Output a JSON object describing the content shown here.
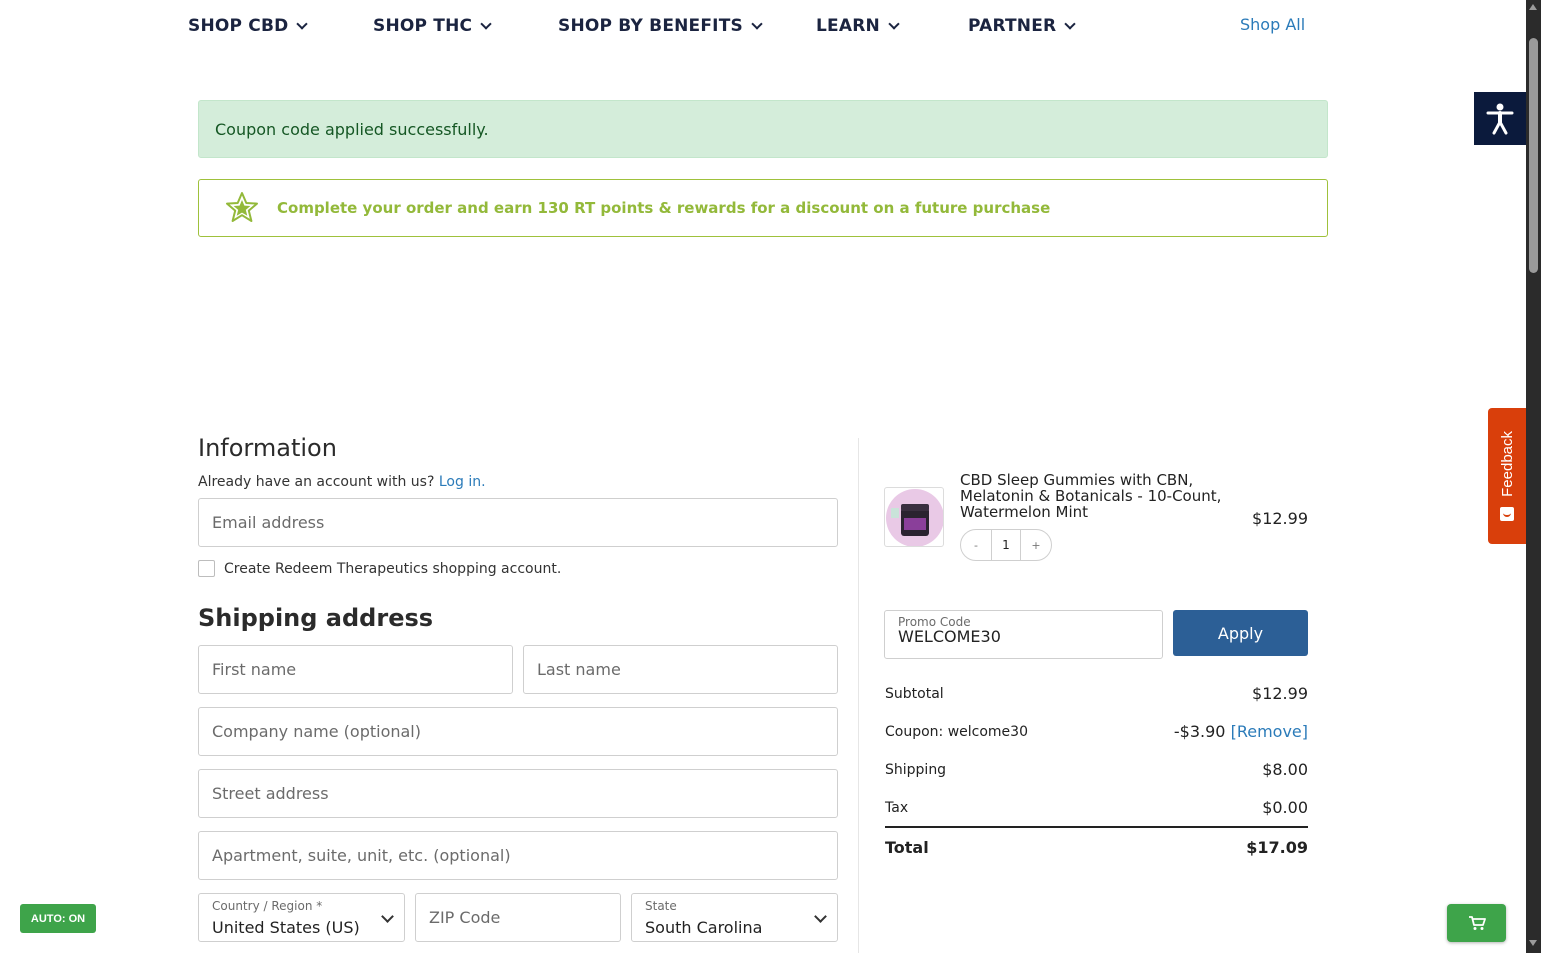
{
  "nav": {
    "items": [
      {
        "label": "SHOP CBD"
      },
      {
        "label": "SHOP THC"
      },
      {
        "label": "SHOP BY BENEFITS"
      },
      {
        "label": "LEARN"
      },
      {
        "label": "PARTNER"
      }
    ],
    "shop_all": "Shop All"
  },
  "notices": {
    "success": "Coupon code applied successfully.",
    "rewards": "Complete your order and earn 130 RT points & rewards for a discount on a future purchase"
  },
  "information": {
    "heading": "Information",
    "account_prompt": "Already have an account with us?",
    "login_link": "Log in.",
    "email_placeholder": "Email address",
    "create_account_label": "Create Redeem Therapeutics shopping account."
  },
  "shipping": {
    "heading": "Shipping address",
    "first_name_placeholder": "First name",
    "last_name_placeholder": "Last name",
    "company_placeholder": "Company name (optional)",
    "street_placeholder": "Street address",
    "apartment_placeholder": "Apartment, suite, unit, etc. (optional)",
    "country_label": "Country / Region *",
    "country_value": "United States (US)",
    "zip_placeholder": "ZIP Code",
    "state_label": "State",
    "state_value": "South Carolina"
  },
  "order": {
    "product_title": "CBD Sleep Gummies with CBN, Melatonin & Botanicals - 10-Count, Watermelon Mint",
    "product_price": "$12.99",
    "quantity": "1",
    "qty_minus": "-",
    "qty_plus": "+",
    "promo_label": "Promo Code",
    "promo_value": "WELCOME30",
    "apply_label": "Apply",
    "subtotal_label": "Subtotal",
    "subtotal_value": "$12.99",
    "coupon_label": "Coupon: welcome30",
    "coupon_value": "-$3.90",
    "coupon_remove": "[Remove]",
    "shipping_label": "Shipping",
    "shipping_value": "$8.00",
    "tax_label": "Tax",
    "tax_value": "$0.00",
    "total_label": "Total",
    "total_value": "$17.09"
  },
  "widgets": {
    "feedback_label": "Feedback",
    "auto_badge": "AUTO: ON"
  },
  "colors": {
    "nav_text": "#1b2440",
    "link": "#2b7bb9",
    "success_bg": "#d4edda",
    "rewards_green": "#93b93a",
    "apply_button": "#2c5f96",
    "feedback_tab": "#d93f0b",
    "badge_green": "#3ea44a"
  },
  "icons": [
    "chevron-down-icon",
    "star-icon",
    "accessibility-icon",
    "feedback-icon",
    "cart-icon",
    "select-chevron-icon"
  ]
}
